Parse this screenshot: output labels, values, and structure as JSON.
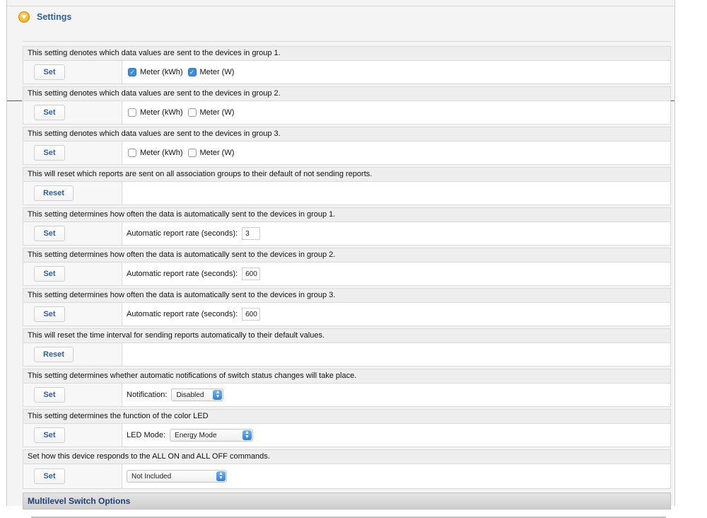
{
  "section": {
    "title": "Settings",
    "toggle_icon": "collapse-arrow-icon"
  },
  "rows": [
    {
      "desc": "This setting denotes which data values are sent to the devices in group 1.",
      "button": "Set",
      "type": "checkboxes",
      "options": [
        {
          "label": "Meter (kWh)",
          "checked": true
        },
        {
          "label": "Meter (W)",
          "checked": true
        }
      ]
    },
    {
      "desc": "This setting denotes which data values are sent to the devices in group 2.",
      "button": "Set",
      "type": "checkboxes",
      "options": [
        {
          "label": "Meter (kWh)",
          "checked": false
        },
        {
          "label": "Meter (W)",
          "checked": false
        }
      ]
    },
    {
      "desc": "This setting denotes which data values are sent to the devices in group 3.",
      "button": "Set",
      "type": "checkboxes",
      "options": [
        {
          "label": "Meter (kWh)",
          "checked": false
        },
        {
          "label": "Meter (W)",
          "checked": false
        }
      ]
    },
    {
      "desc": "This will reset which reports are sent on all association groups to their default of not sending reports.",
      "button": "Reset",
      "type": "empty"
    },
    {
      "desc": "This setting determines how often the data is automatically sent to the devices in group 1.",
      "button": "Set",
      "type": "input",
      "label": "Automatic report rate (seconds):",
      "value": "3"
    },
    {
      "desc": "This setting determines how often the data is automatically sent to the devices in group 2.",
      "button": "Set",
      "type": "input",
      "label": "Automatic report rate (seconds):",
      "value": "600"
    },
    {
      "desc": "This setting determines how often the data is automatically sent to the devices in group 3.",
      "button": "Set",
      "type": "input",
      "label": "Automatic report rate (seconds):",
      "value": "600"
    },
    {
      "desc": "This will reset the time interval for sending reports automatically to their default values.",
      "button": "Reset",
      "type": "empty"
    },
    {
      "desc": "This setting determines whether automatic notifications of switch status changes will take place.",
      "button": "Set",
      "type": "select",
      "label": "Notification:",
      "value": "Disabled"
    },
    {
      "desc": "This setting determines the function of the color LED",
      "button": "Set",
      "type": "select",
      "label": "LED Mode:",
      "value": "Energy Mode"
    },
    {
      "desc": "Set how this device responds to the ALL ON and ALL OFF commands.",
      "button": "Set",
      "type": "select",
      "label": "",
      "value": "Not Included"
    }
  ],
  "subsection": {
    "title": "Multilevel Switch Options"
  },
  "colors": {
    "accent": "#2e5fa7",
    "checkbox_on": "#3b8ce3",
    "toggle": "#f0a500"
  }
}
